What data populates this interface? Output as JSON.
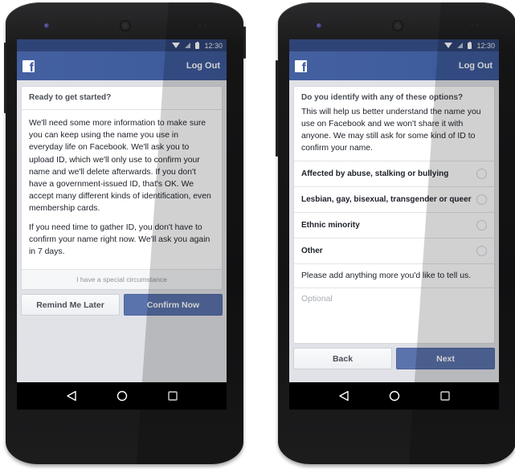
{
  "status_bar": {
    "time": "12:30"
  },
  "app_bar": {
    "logo_glyph": "f",
    "logout_label": "Log Out"
  },
  "colors": {
    "brand_blue": "#3b5998",
    "status_bar": "#2f4476",
    "primary_button": "#5b73ac",
    "screen_background": "#e1e2e7"
  },
  "screen1": {
    "card_title": "Ready to get started?",
    "paragraphs": [
      "We'll need some more information to make sure you can keep using the name you use in everyday life on Facebook. We'll ask you to upload ID, which we'll only use to confirm your name and we'll delete afterwards. If you don't have a government-issued ID, that's OK. We accept many different kinds of identification, even membership cards.",
      "If you need time to gather ID, you don't have to confirm your name right now. We'll ask you again in 7 days."
    ],
    "footer_link": "I have a special circumstance",
    "secondary_button": "Remind Me Later",
    "primary_button": "Confirm Now"
  },
  "screen2": {
    "question_title": "Do you identify with any of these options?",
    "question_description": "This will help us better understand the name you use on Facebook and we won't share it with anyone. We may still ask for some kind of ID to confirm your name.",
    "options": [
      {
        "label": "Affected by abuse, stalking or bullying",
        "selected": false
      },
      {
        "label": "Lesbian, gay, bisexual, transgender or queer",
        "selected": false
      },
      {
        "label": "Ethnic minority",
        "selected": false
      },
      {
        "label": "Other",
        "selected": false
      }
    ],
    "more_label": "Please add anything more you'd like to tell us.",
    "more_input_placeholder": "Optional",
    "more_input_value": "",
    "secondary_button": "Back",
    "primary_button": "Next"
  },
  "nav_bar": {
    "icons": [
      "back-icon",
      "home-icon",
      "recents-icon"
    ]
  }
}
